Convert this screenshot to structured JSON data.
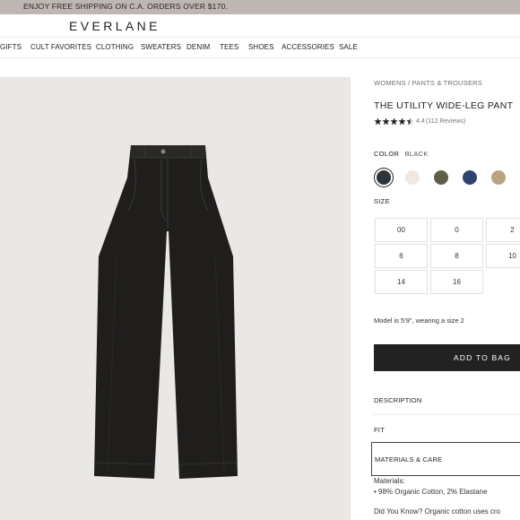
{
  "promo": {
    "text": "ENJOY FREE SHIPPING ON C.A. ORDERS OVER $170."
  },
  "brand": {
    "logo": "EVERLANE"
  },
  "nav": {
    "items": [
      "GIFTS",
      "CULT FAVORITES",
      "CLOTHING",
      "SWEATERS",
      "DENIM",
      "TEES",
      "SHOES",
      "ACCESSORIES",
      "SALE"
    ]
  },
  "product": {
    "breadcrumb": "WOMENS / PANTS & TROUSERS",
    "title": "THE UTILITY WIDE-LEG PANT",
    "rating": "4.4",
    "stars": 4.5,
    "reviews": "(112 Reviews)",
    "color_label": "COLOR",
    "color_value": "BLACK",
    "swatches": [
      {
        "name": "black",
        "hex": "#2f3438",
        "selected": true
      },
      {
        "name": "cream",
        "hex": "#f1e8e1",
        "selected": false
      },
      {
        "name": "olive",
        "hex": "#5d5d48",
        "selected": false
      },
      {
        "name": "navy",
        "hex": "#2f4373",
        "selected": false
      },
      {
        "name": "khaki",
        "hex": "#b9a47f",
        "selected": false
      }
    ],
    "size_label": "SIZE",
    "sizes": [
      "00",
      "0",
      "2",
      "6",
      "8",
      "10",
      "14",
      "16"
    ],
    "model_note": "Model is 5'9\", wearing a size 2",
    "add_to_bag": "ADD TO BAG",
    "accordion": {
      "description": "DESCRIPTION",
      "fit": "FIT",
      "materials": "MATERIALS & CARE"
    },
    "materials_heading": "Materials:",
    "materials_item": "• 98% Organic Cotton, 2% Elastane",
    "did_you_know": "Did You Know? Organic cotton uses cro"
  }
}
